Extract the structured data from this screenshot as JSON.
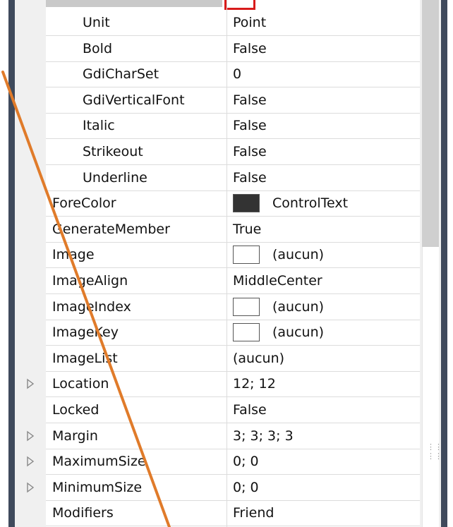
{
  "properties": [
    {
      "name": "Unit",
      "value": "Point",
      "indent": true
    },
    {
      "name": "Bold",
      "value": "False",
      "indent": true
    },
    {
      "name": "GdiCharSet",
      "value": "0",
      "indent": true
    },
    {
      "name": "GdiVerticalFont",
      "value": "False",
      "indent": true
    },
    {
      "name": "Italic",
      "value": "False",
      "indent": true
    },
    {
      "name": "Strikeout",
      "value": "False",
      "indent": true
    },
    {
      "name": "Underline",
      "value": "False",
      "indent": true
    },
    {
      "name": "ForeColor",
      "value": "ControlText",
      "swatch": "#333333"
    },
    {
      "name": "GenerateMember",
      "value": "True"
    },
    {
      "name": "Image",
      "value": "(aucun)",
      "swatch": "#ffffff"
    },
    {
      "name": "ImageAlign",
      "value": "MiddleCenter"
    },
    {
      "name": "ImageIndex",
      "value": "(aucun)",
      "swatch": "#ffffff"
    },
    {
      "name": "ImageKey",
      "value": "(aucun)",
      "swatch": "#ffffff"
    },
    {
      "name": "ImageList",
      "value": "(aucun)"
    },
    {
      "name": "Location",
      "value": "12; 12",
      "expandable": true
    },
    {
      "name": "Locked",
      "value": "False"
    },
    {
      "name": "Margin",
      "value": "3; 3; 3; 3",
      "expandable": true
    },
    {
      "name": "MaximumSize",
      "value": "0; 0",
      "expandable": true
    },
    {
      "name": "MinimumSize",
      "value": "0; 0",
      "expandable": true
    },
    {
      "name": "Modifiers",
      "value": "Friend"
    }
  ],
  "colors": {
    "frame": "#3f4a5c",
    "annotation_line": "#e07b2a",
    "highlight_box": "#d81b1b"
  },
  "icons": {
    "expander": "triangle-right-icon",
    "grip": "grip-dots-icon"
  }
}
